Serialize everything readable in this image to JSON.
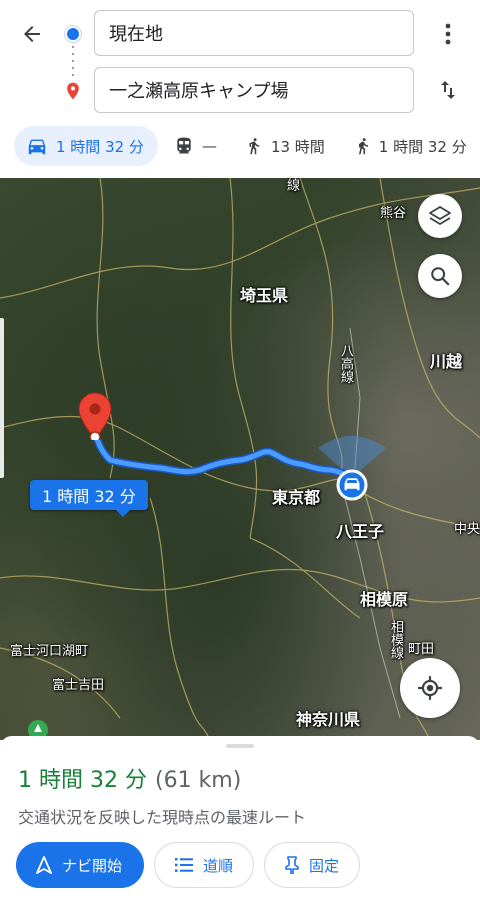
{
  "search": {
    "origin_value": "現在地",
    "destination_value": "一之瀬高原キャンプ場"
  },
  "modes": [
    {
      "id": "drive",
      "label": "1 時間 32 分",
      "icon": "car-icon",
      "active": true
    },
    {
      "id": "transit",
      "label": "—",
      "icon": "train-icon",
      "active": false
    },
    {
      "id": "walk",
      "label": "13 時間",
      "icon": "walk-icon",
      "active": false
    },
    {
      "id": "ride",
      "label": "1 時間 32 分",
      "icon": "rideshare-icon",
      "active": false
    }
  ],
  "map": {
    "labels": {
      "saitama": "埼玉県",
      "kawagoe": "川越",
      "kumagaya": "熊谷",
      "tokyo": "東京都",
      "hachioji": "八王子",
      "sagamihara": "相模原",
      "fujikawaguchiko": "富士河口湖町",
      "fujiyoshida": "富士吉田",
      "kanagawa": "神奈川県",
      "machida": "町田",
      "hachiko_line": "八高線",
      "chuo": "中央",
      "sagami_line": "相模線",
      "ken": "線"
    },
    "route_badge": "1 時間 32 分",
    "route_color": "#4a9cff"
  },
  "sheet": {
    "duration": "1 時間 32 分",
    "distance": "(61 km)",
    "note": "交通状況を反映した現時点の最速ルート",
    "buttons": {
      "start": "ナビ開始",
      "steps": "道順",
      "pin": "固定"
    }
  },
  "colors": {
    "accent": "#1a73e8",
    "duration_green": "#188038"
  }
}
